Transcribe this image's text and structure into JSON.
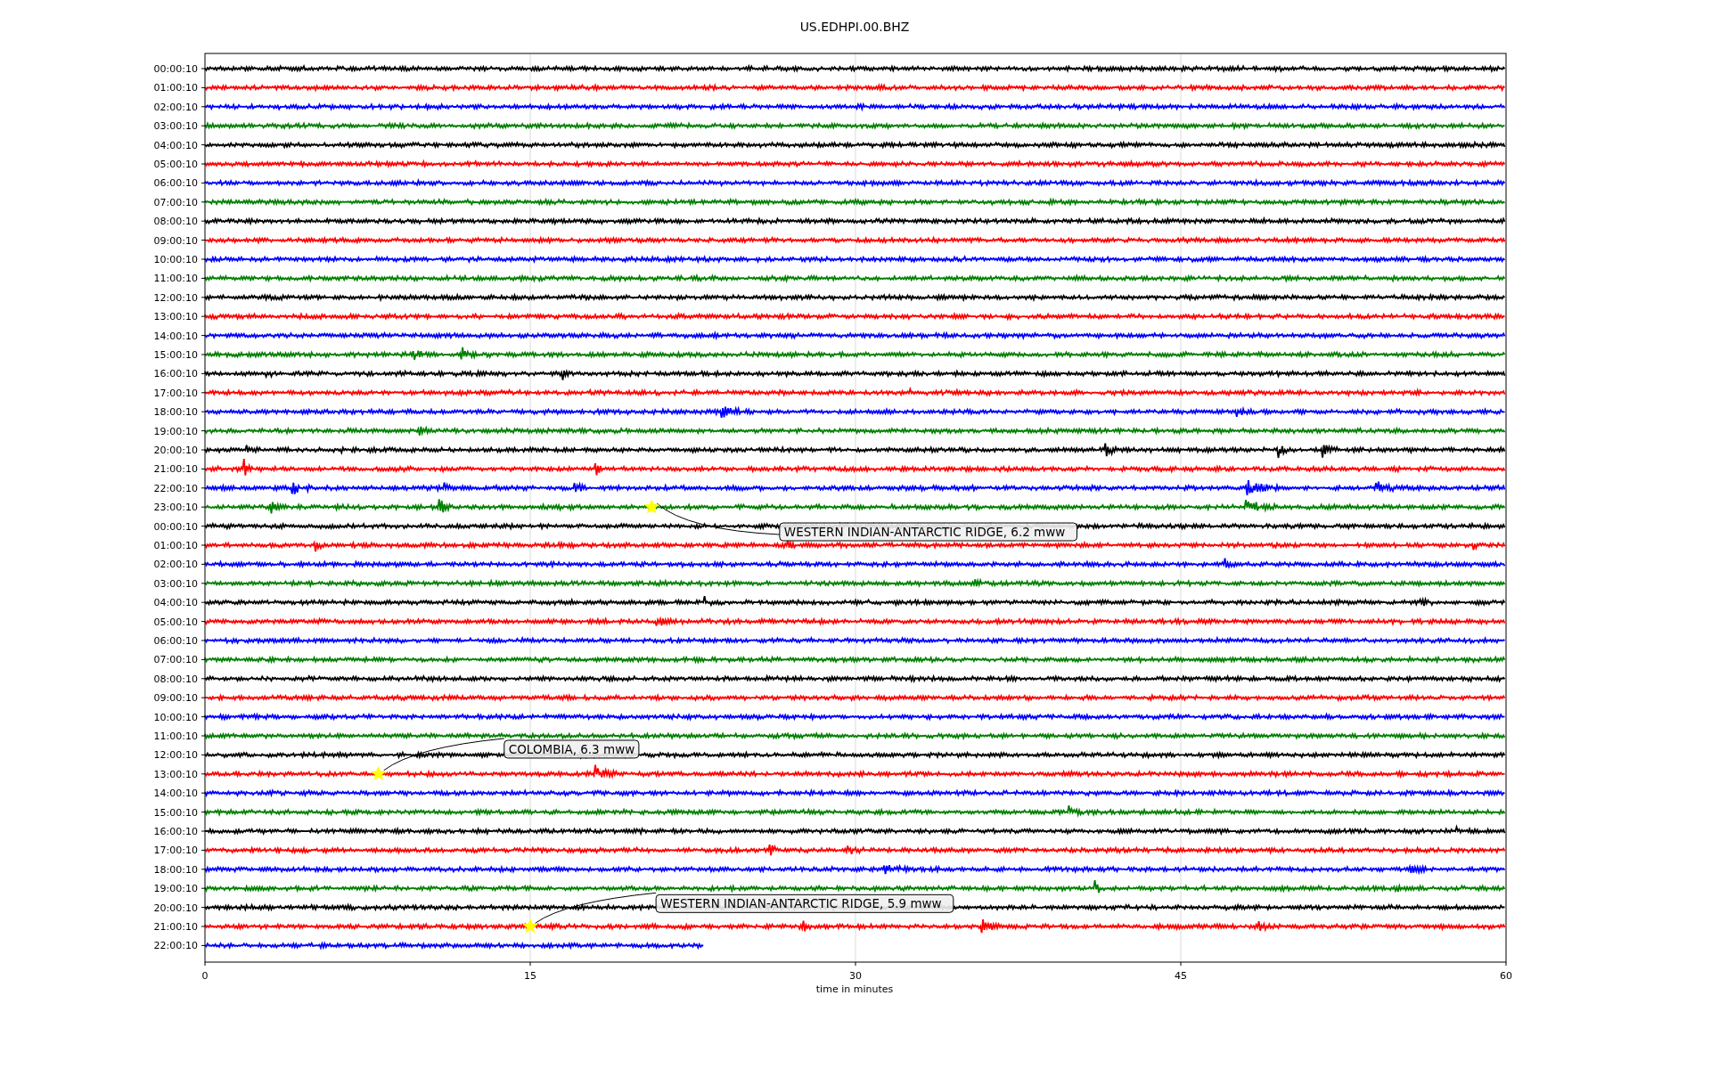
{
  "seismogram": {
    "title": "US.EDHPI.00.BHZ",
    "xlabel": "time in minutes",
    "xticks": [
      "0",
      "15",
      "30",
      "45",
      "60"
    ],
    "rows": [
      {
        "label": "00:00:10",
        "color": "#000000",
        "partial": false
      },
      {
        "label": "01:00:10",
        "color": "#ff0000",
        "partial": false
      },
      {
        "label": "02:00:10",
        "color": "#0000ff",
        "partial": false
      },
      {
        "label": "03:00:10",
        "color": "#008000",
        "partial": false
      },
      {
        "label": "04:00:10",
        "color": "#000000",
        "partial": false
      },
      {
        "label": "05:00:10",
        "color": "#ff0000",
        "partial": false
      },
      {
        "label": "06:00:10",
        "color": "#0000ff",
        "partial": false
      },
      {
        "label": "07:00:10",
        "color": "#008000",
        "partial": false
      },
      {
        "label": "08:00:10",
        "color": "#000000",
        "partial": false
      },
      {
        "label": "09:00:10",
        "color": "#ff0000",
        "partial": false
      },
      {
        "label": "10:00:10",
        "color": "#0000ff",
        "partial": false
      },
      {
        "label": "11:00:10",
        "color": "#008000",
        "partial": false
      },
      {
        "label": "12:00:10",
        "color": "#000000",
        "partial": false
      },
      {
        "label": "13:00:10",
        "color": "#ff0000",
        "partial": false
      },
      {
        "label": "14:00:10",
        "color": "#0000ff",
        "partial": false
      },
      {
        "label": "15:00:10",
        "color": "#008000",
        "partial": false
      },
      {
        "label": "16:00:10",
        "color": "#000000",
        "partial": false
      },
      {
        "label": "17:00:10",
        "color": "#ff0000",
        "partial": false
      },
      {
        "label": "18:00:10",
        "color": "#0000ff",
        "partial": false
      },
      {
        "label": "19:00:10",
        "color": "#008000",
        "partial": false
      },
      {
        "label": "20:00:10",
        "color": "#000000",
        "partial": false
      },
      {
        "label": "21:00:10",
        "color": "#ff0000",
        "partial": false
      },
      {
        "label": "22:00:10",
        "color": "#0000ff",
        "partial": false
      },
      {
        "label": "23:00:10",
        "color": "#008000",
        "partial": false
      },
      {
        "label": "00:00:10",
        "color": "#000000",
        "partial": false
      },
      {
        "label": "01:00:10",
        "color": "#ff0000",
        "partial": false
      },
      {
        "label": "02:00:10",
        "color": "#0000ff",
        "partial": false
      },
      {
        "label": "03:00:10",
        "color": "#008000",
        "partial": false
      },
      {
        "label": "04:00:10",
        "color": "#000000",
        "partial": false
      },
      {
        "label": "05:00:10",
        "color": "#ff0000",
        "partial": false
      },
      {
        "label": "06:00:10",
        "color": "#0000ff",
        "partial": false
      },
      {
        "label": "07:00:10",
        "color": "#008000",
        "partial": false
      },
      {
        "label": "08:00:10",
        "color": "#000000",
        "partial": false
      },
      {
        "label": "09:00:10",
        "color": "#ff0000",
        "partial": false
      },
      {
        "label": "10:00:10",
        "color": "#0000ff",
        "partial": false
      },
      {
        "label": "11:00:10",
        "color": "#008000",
        "partial": false
      },
      {
        "label": "12:00:10",
        "color": "#000000",
        "partial": false
      },
      {
        "label": "13:00:10",
        "color": "#ff0000",
        "partial": false
      },
      {
        "label": "14:00:10",
        "color": "#0000ff",
        "partial": false
      },
      {
        "label": "15:00:10",
        "color": "#008000",
        "partial": false
      },
      {
        "label": "16:00:10",
        "color": "#000000",
        "partial": false
      },
      {
        "label": "17:00:10",
        "color": "#ff0000",
        "partial": false
      },
      {
        "label": "18:00:10",
        "color": "#0000ff",
        "partial": false
      },
      {
        "label": "19:00:10",
        "color": "#008000",
        "partial": false
      },
      {
        "label": "20:00:10",
        "color": "#000000",
        "partial": false
      },
      {
        "label": "21:00:10",
        "color": "#ff0000",
        "partial": false
      },
      {
        "label": "22:00:10",
        "color": "#0000ff",
        "partial": true
      }
    ],
    "events": [
      {
        "text": "WESTERN INDIAN-ANTARCTIC RIDGE, 6.2 mww"
      },
      {
        "text": "COLOMBIA, 6.3 mww"
      },
      {
        "text": "WESTERN INDIAN-ANTARCTIC RIDGE, 5.9 mww"
      }
    ]
  }
}
